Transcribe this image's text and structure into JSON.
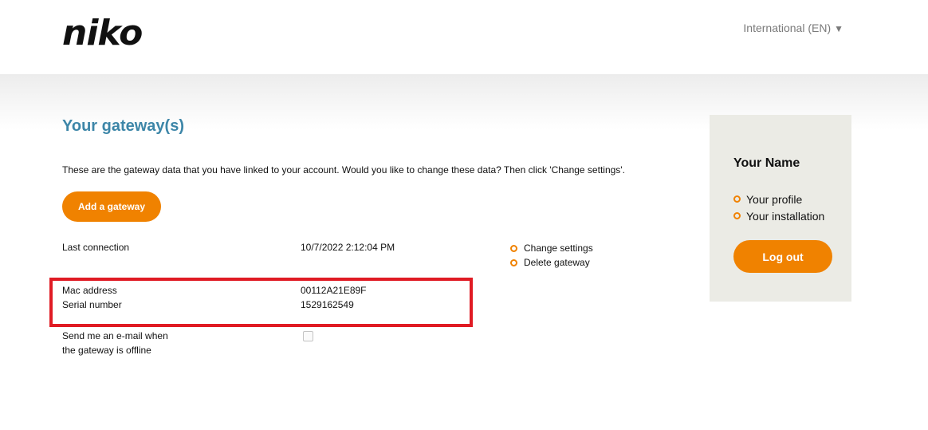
{
  "header": {
    "logo_text": "niko",
    "language": "International (EN)",
    "language_caret": "▼"
  },
  "main": {
    "title": "Your gateway(s)",
    "intro": "These are the gateway data that you have linked to your account. Would you like to change these data? Then click 'Change settings'.",
    "add_button": "Add a gateway",
    "last_connection": {
      "label": "Last connection",
      "value": "10/7/2022 2:12:04 PM"
    },
    "actions": [
      {
        "label": "Change settings"
      },
      {
        "label": "Delete gateway"
      }
    ],
    "mac_address": {
      "label": "Mac address",
      "value": "00112A21E89F"
    },
    "serial_number": {
      "label": "Serial number",
      "value": "1529162549"
    },
    "offline_email": {
      "label_line1": "Send me an e-mail when",
      "label_line2": "the gateway is offline",
      "checked": false
    },
    "highlight_color": "#e01b24"
  },
  "sidebar": {
    "name": "Your Name",
    "links": [
      {
        "label": "Your profile"
      },
      {
        "label": "Your installation"
      }
    ],
    "logout": "Log out"
  },
  "colors": {
    "accent_orange": "#f08200",
    "title_blue": "#3d86a8",
    "panel_bg": "#ebebe5"
  }
}
